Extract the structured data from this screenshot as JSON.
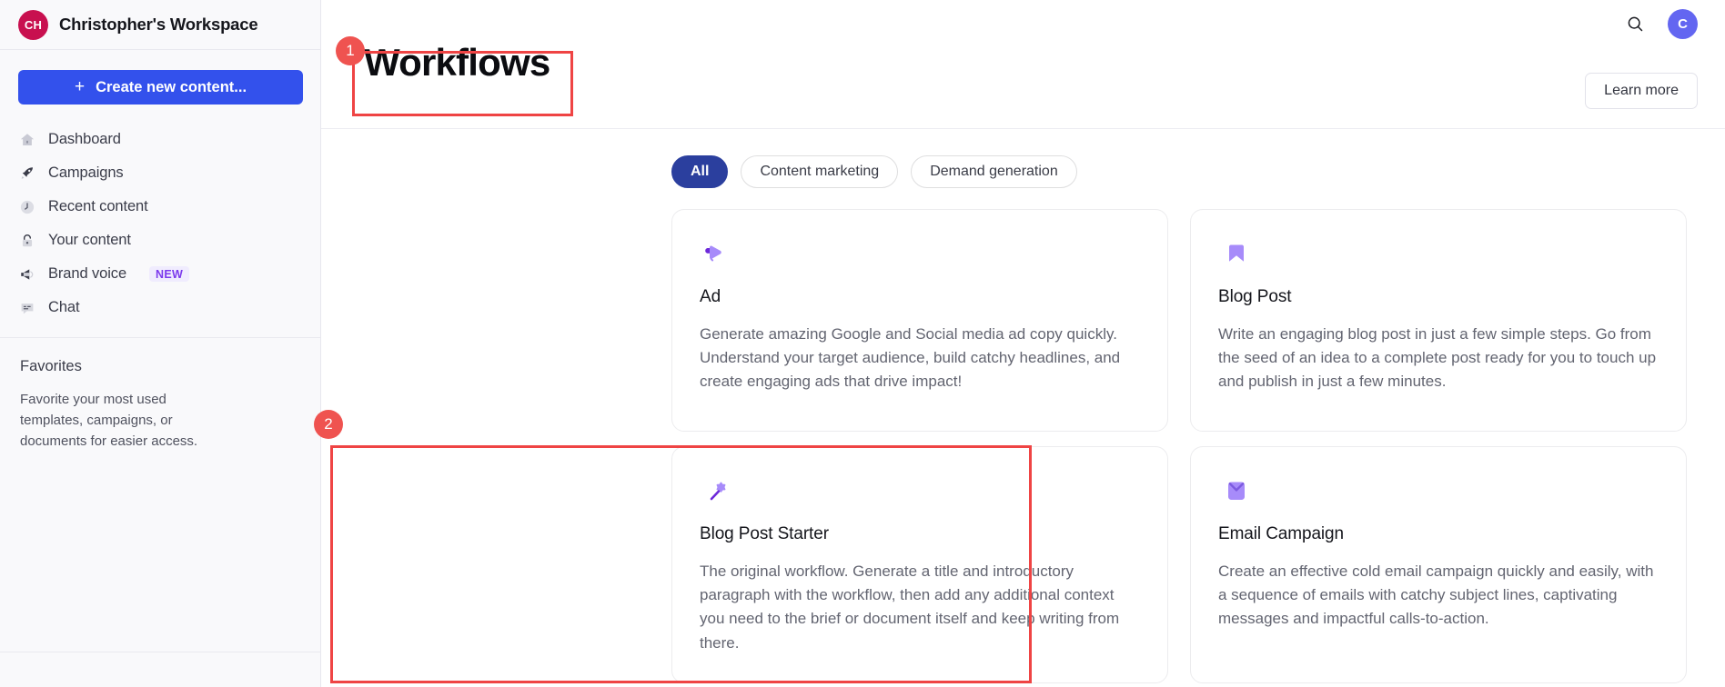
{
  "sidebar": {
    "workspace": {
      "initials": "CH",
      "name": "Christopher's Workspace",
      "logo_color": "#c8104f"
    },
    "create_button": {
      "label": "Create new content...",
      "icon": "plus-icon",
      "color": "#3351ec"
    },
    "nav_items": [
      {
        "label": "Dashboard",
        "icon": "home-icon",
        "badge": ""
      },
      {
        "label": "Campaigns",
        "icon": "rocket-icon",
        "badge": ""
      },
      {
        "label": "Recent content",
        "icon": "clock-icon",
        "badge": ""
      },
      {
        "label": "Your content",
        "icon": "lock-icon",
        "badge": ""
      },
      {
        "label": "Brand voice",
        "icon": "megaphone-icon",
        "badge": "NEW"
      },
      {
        "label": "Chat",
        "icon": "chat-bubble-icon",
        "badge": ""
      }
    ],
    "favorites": {
      "title": "Favorites",
      "description": "Favorite your most used templates, campaigns, or documents for easier access."
    }
  },
  "header": {
    "title": "Workflows",
    "search_icon": "search-icon",
    "avatar_letter": "C",
    "avatar_color": "#6366f1",
    "learn_more_label": "Learn more"
  },
  "filters": {
    "chips": [
      {
        "label": "All",
        "active": true
      },
      {
        "label": "Content marketing",
        "active": false
      },
      {
        "label": "Demand generation",
        "active": false
      }
    ],
    "active_color": "#2b3f9e"
  },
  "workflows": [
    {
      "title": "Ad",
      "icon": "megaphone-icon",
      "description": "Generate amazing Google and Social media ad copy quickly. Understand your target audience, build catchy headlines, and create engaging ads that drive impact!"
    },
    {
      "title": "Blog Post",
      "icon": "bookmark-icon",
      "description": "Write an engaging blog post in just a few simple steps. Go from the seed of an idea to a complete post ready for you to touch up and publish in just a few minutes."
    },
    {
      "title": "Blog Post Starter",
      "icon": "magic-wand-icon",
      "description": "The original workflow. Generate a title and introductory paragraph with the workflow, then add any additional context you need to the brief or document itself and keep writing from there."
    },
    {
      "title": "Email Campaign",
      "icon": "envelope-icon",
      "description": "Create an effective cold email campaign quickly and easily, with a sequence of emails with catchy subject lines, captivating messages and impactful calls-to-action."
    }
  ],
  "annotations": {
    "color": "#ef4444",
    "markers": [
      {
        "number": "1",
        "target": "page-title"
      },
      {
        "number": "2",
        "target": "blog-post-starter-card"
      }
    ]
  }
}
